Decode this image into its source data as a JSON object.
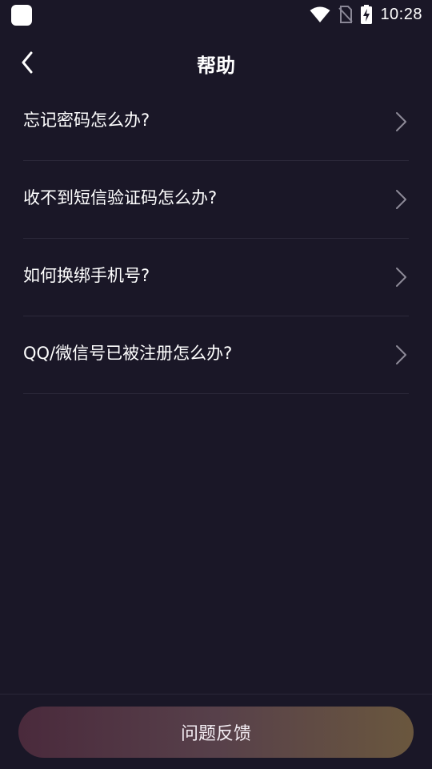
{
  "status_bar": {
    "time": "10:28"
  },
  "header": {
    "title": "帮助"
  },
  "help_items": [
    {
      "label": "忘记密码怎么办?"
    },
    {
      "label": "收不到短信验证码怎么办?"
    },
    {
      "label": "如何换绑手机号?"
    },
    {
      "label": "QQ/微信号已被注册怎么办?"
    }
  ],
  "footer": {
    "feedback_label": "问题反馈"
  },
  "colors": {
    "background": "#1a1727",
    "divider": "#2d2a3b",
    "button_gradient_start": "#4a2a3c",
    "button_gradient_end": "#6a573e"
  }
}
